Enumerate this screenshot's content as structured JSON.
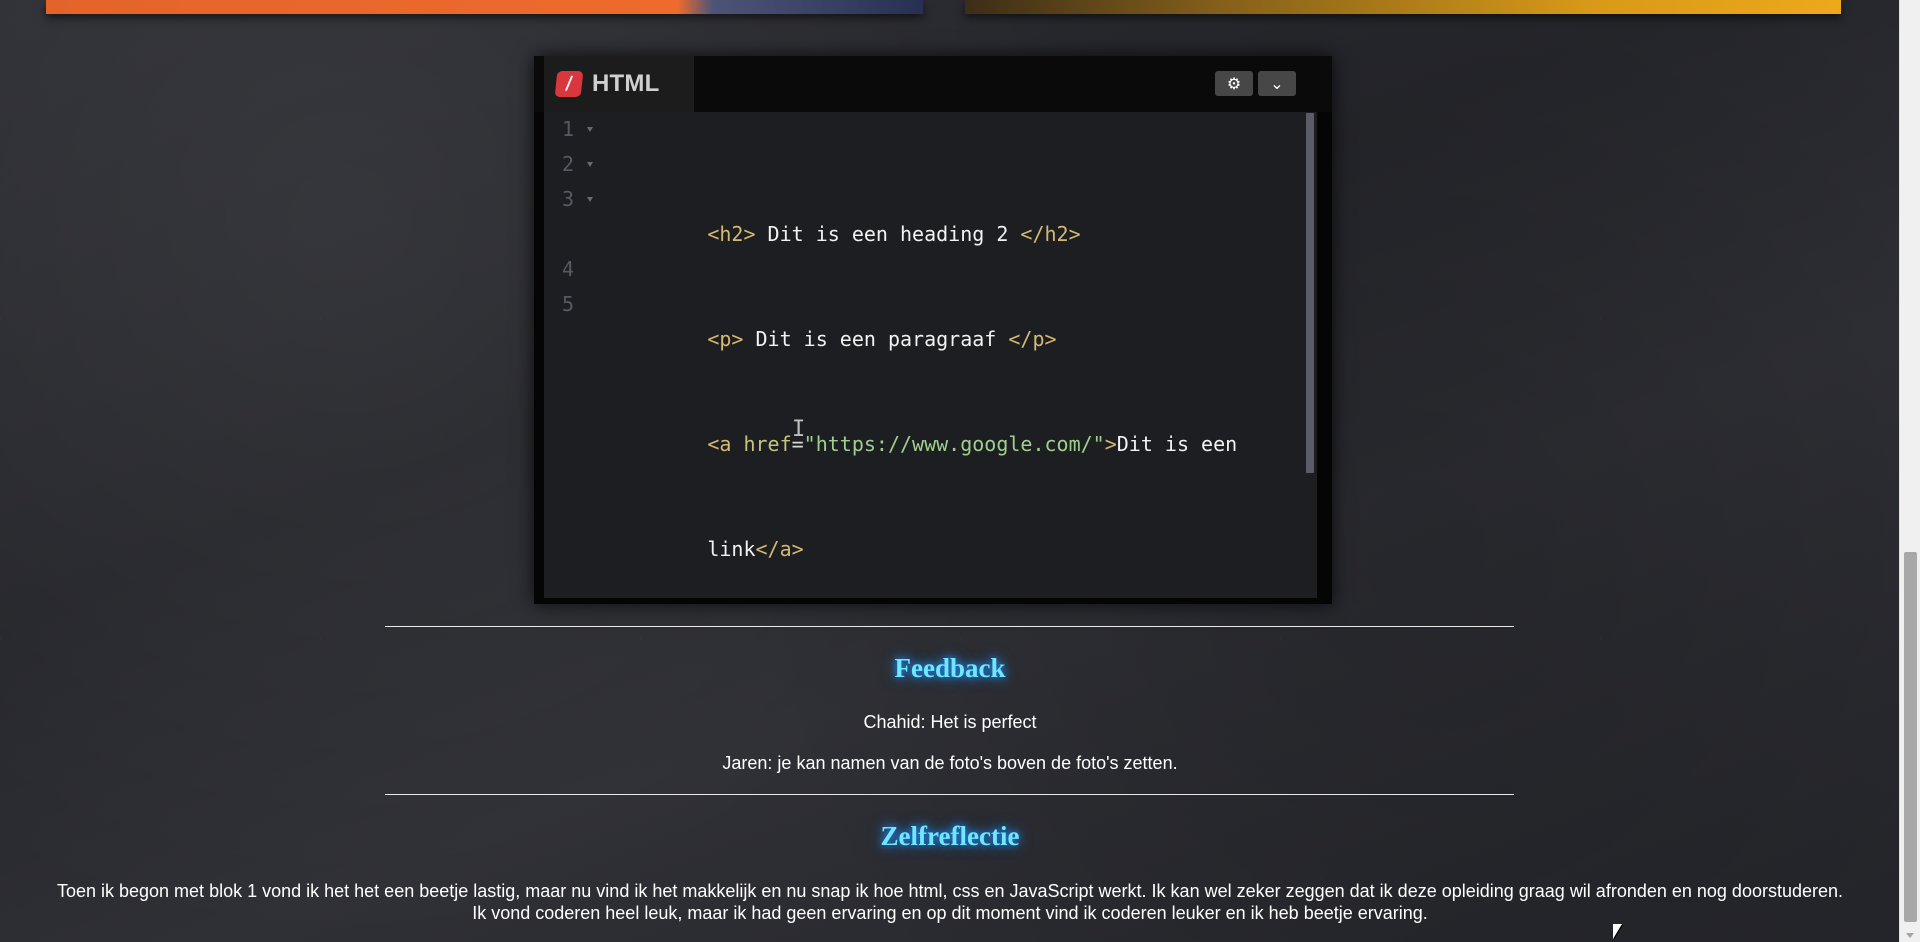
{
  "editor": {
    "tab_label": "HTML",
    "logo_glyph": "/",
    "settings_icon": "gear-icon",
    "collapse_icon": "chevron-down-icon",
    "line_numbers": [
      "1",
      "2",
      "3",
      "",
      "4",
      "5"
    ],
    "code": {
      "line1": {
        "open": "<h2>",
        "text": " Dit is een heading 2 ",
        "close": "</h2>"
      },
      "line2": {
        "open": "<p>",
        "text": " Dit is een paragraaf ",
        "close": "</p>"
      },
      "line3": {
        "open_start": "<a ",
        "attr_name": "href",
        "equals": "=",
        "attr_value": "\"https://www.google.com/\"",
        "open_end": ">",
        "text_part1": "Dit is een"
      },
      "line3_wrap": {
        "text_part2": "link",
        "close": "</a>"
      }
    }
  },
  "sections": {
    "feedback": {
      "title": "Feedback",
      "items": [
        "Chahid: Het is perfect",
        "Jaren: je kan namen van de foto's boven de foto's zetten."
      ]
    },
    "reflection": {
      "title": "Zelfreflectie",
      "lines": [
        "Toen ik begon met blok 1 vond ik het het een beetje lastig, maar nu vind ik het makkelijk en nu snap ik hoe html, css en JavaScript werkt. Ik kan wel zeker zeggen dat ik deze opleiding graag wil afronden en nog doorstuderen.",
        "Ik vond coderen heel leuk, maar ik had geen ervaring en op dit moment vind ik coderen leuker en ik heb beetje ervaring."
      ]
    }
  },
  "colors": {
    "accent_title": "#6ee7ff",
    "title_glow": "#1e8fff",
    "editor_background": "#1d1e22",
    "html_logo": "#d9363e",
    "code_tag": "#d3b972",
    "code_string": "#9fcf8e"
  }
}
